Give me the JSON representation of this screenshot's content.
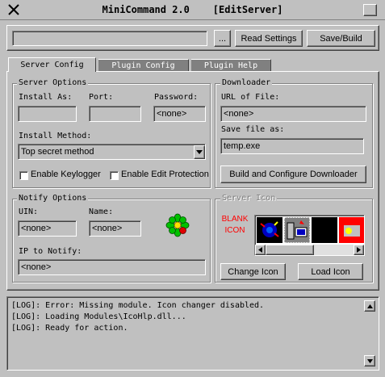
{
  "window": {
    "title": "MiniCommand 2.0    [EditServer]"
  },
  "toolbar": {
    "path_value": "",
    "browse_label": "...",
    "read_settings_label": "Read Settings",
    "save_build_label": "Save/Build"
  },
  "tabs": [
    {
      "label": "Server Config",
      "active": true
    },
    {
      "label": "Plugin Config",
      "active": false
    },
    {
      "label": "Plugin Help",
      "active": false
    }
  ],
  "server_options": {
    "legend": "Server Options",
    "install_as_label": "Install As:",
    "install_as_value": "",
    "port_label": "Port:",
    "port_value": "",
    "password_label": "Password:",
    "password_value": "<none>",
    "install_method_label": "Install Method:",
    "install_method_value": "Top secret method",
    "keylogger_label": "Enable Keylogger",
    "keylogger_checked": false,
    "edit_protection_label": "Enable Edit Protection",
    "edit_protection_checked": false
  },
  "downloader": {
    "legend": "Downloader",
    "url_label": "URL of File:",
    "url_value": "<none>",
    "save_as_label": "Save file as:",
    "save_as_value": "temp.exe",
    "build_button_label": "Build and Configure Downloader"
  },
  "notify_options": {
    "legend": "Notify Options",
    "uin_label": "UIN:",
    "uin_value": "<none>",
    "name_label": "Name:",
    "name_value": "<none>",
    "ip_label": "IP to Notify:",
    "ip_value": "<none>",
    "icq_icon": "icq-flower-icon"
  },
  "server_icon": {
    "legend": "Server Icon",
    "blank_line1": "BLANK",
    "blank_line2": "ICON",
    "change_icon_label": "Change Icon",
    "load_icon_label": "Load Icon",
    "icons": [
      "globe-sync-icon",
      "computer-icon",
      "black-icon",
      "red-icon"
    ]
  },
  "log": {
    "lines": [
      "[LOG]: Error: Missing module. Icon changer disabled.",
      "[LOG]: Loading Modules\\IcoHlp.dll...",
      "[LOG]: Ready for action."
    ]
  },
  "colors": {
    "accent_red": "#ff0000",
    "disabled_text": "#808080",
    "icq_green": "#00c000"
  }
}
